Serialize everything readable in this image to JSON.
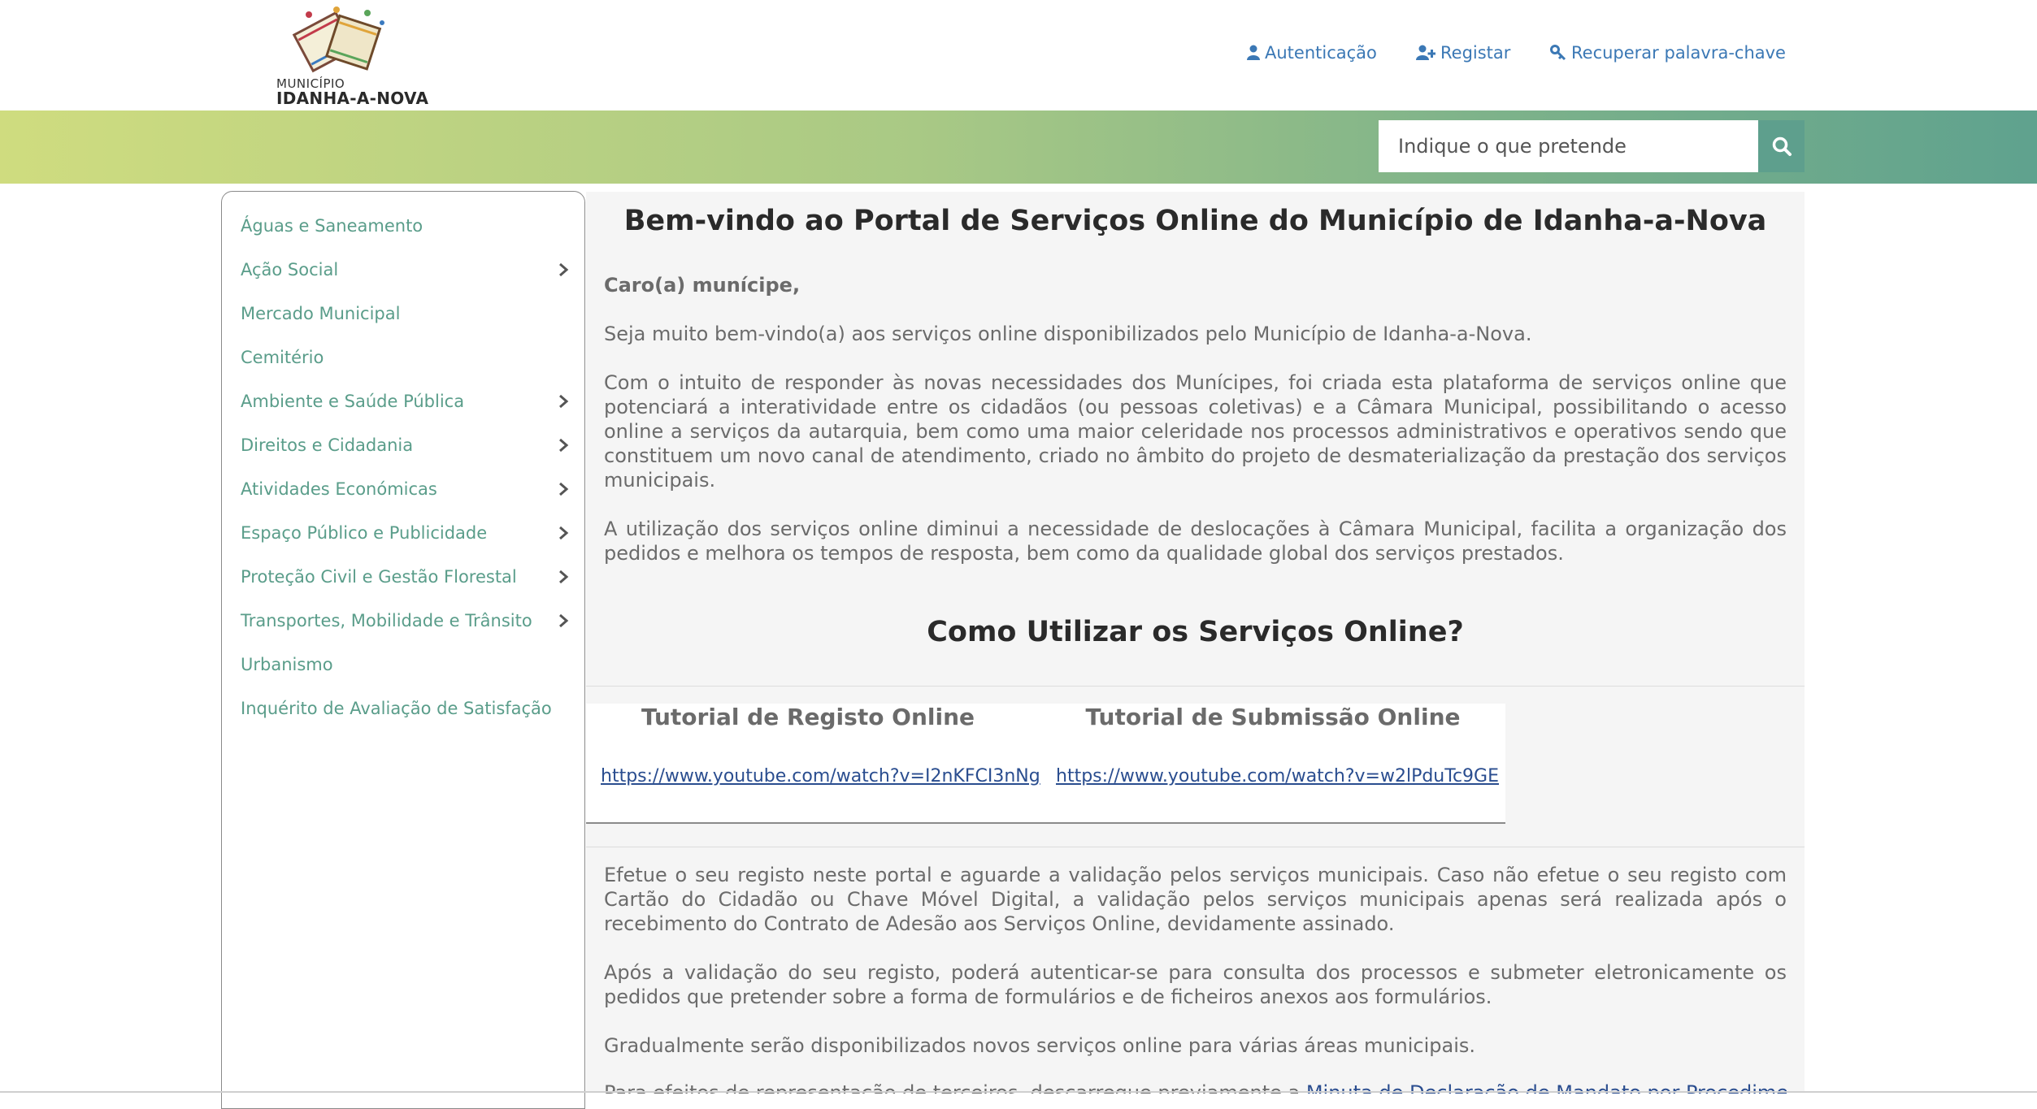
{
  "header": {
    "logo": {
      "icon": "books-logo-icon",
      "line1": "MUNICÍPIO",
      "line2": "IDANHA-A-NOVA"
    },
    "links": [
      {
        "icon": "user-icon",
        "label": "Autenticação"
      },
      {
        "icon": "user-plus-icon",
        "label": "Registar"
      },
      {
        "icon": "key-icon",
        "label": "Recuperar palavra-chave"
      }
    ],
    "search": {
      "placeholder": "Indique o que pretende",
      "icon": "search-icon"
    }
  },
  "colors": {
    "band_start": "#cfdc7f",
    "band_end": "#5fa28e",
    "sidebar_text": "#5a9d8a",
    "link": "#3b78b5",
    "tutorial_link": "#2a4d8f"
  },
  "sidebar": {
    "items": [
      {
        "label": "Águas e Saneamento",
        "submenu": false
      },
      {
        "label": "Ação Social",
        "submenu": true
      },
      {
        "label": "Mercado Municipal",
        "submenu": false
      },
      {
        "label": "Cemitério",
        "submenu": false
      },
      {
        "label": "Ambiente e Saúde Pública",
        "submenu": true
      },
      {
        "label": "Direitos e Cidadania",
        "submenu": true
      },
      {
        "label": "Atividades Económicas",
        "submenu": true
      },
      {
        "label": "Espaço Público e Publicidade",
        "submenu": true
      },
      {
        "label": "Proteção Civil e Gestão Florestal",
        "submenu": true
      },
      {
        "label": "Transportes, Mobilidade e Trânsito",
        "submenu": true
      },
      {
        "label": "Urbanismo",
        "submenu": false
      },
      {
        "label": "Inquérito de Avaliação de Satisfação",
        "submenu": false
      }
    ]
  },
  "main": {
    "welcome_title": "Bem-vindo ao Portal de Serviços Online do Município de Idanha-a-Nova",
    "greeting": "Caro(a) munícipe,",
    "para1": "Seja muito bem-vindo(a) aos serviços online disponibilizados pelo Município de Idanha-a-Nova.",
    "para2": "Com o intuito de responder às novas necessidades dos Munícipes, foi criada esta plataforma de serviços online que potenciará a interatividade entre os cidadãos (ou pessoas coletivas) e a Câmara Municipal, possibilitando o acesso online a serviços da autarquia, bem como uma maior celeridade nos processos administrativos e operativos sendo que constituem um novo canal de atendimento, criado no âmbito do projeto de desmaterialização da prestação dos serviços municipais.",
    "para3": "A utilização dos serviços online diminui a necessidade de deslocações à Câmara Municipal, facilita a organização dos pedidos e melhora os tempos de resposta, bem como da qualidade global dos serviços prestados.",
    "howto_title": "Como Utilizar os Serviços Online?",
    "tutorials": [
      {
        "title": "Tutorial de Registo Online",
        "link": "https://www.youtube.com/watch?v=I2nKFCI3nNg"
      },
      {
        "title": "Tutorial de Submissão Online",
        "link": "https://www.youtube.com/watch?v=w2lPduTc9GE"
      }
    ],
    "para4": "Efetue o seu registo neste portal e aguarde a validação pelos serviços municipais. Caso não efetue o seu registo com Cartão do Cidadão ou Chave Móvel Digital, a validação pelos serviços municipais apenas será realizada após o recebimento do Contrato de Adesão aos Serviços Online, devidamente assinado.",
    "para5": "Após a validação do seu registo, poderá autenticar-se para consulta dos processos e submeter eletronicamente os pedidos que pretender sobre a forma de formulários e de ficheiros anexos aos formulários.",
    "para6": "Gradualmente serão disponibilizados novos serviços online para várias áreas municipais.",
    "para7_start": "Para efeitos de representação de terceiros, descarregue previamente a ",
    "para7_link": "Minuta de Declaração de Mandato por Procedimento"
  }
}
